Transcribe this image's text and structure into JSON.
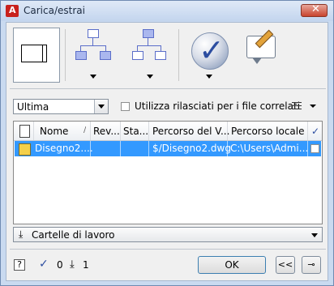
{
  "window": {
    "title": "Carica/estrai",
    "close_glyph": "✕"
  },
  "toolbar": {
    "buttons": [
      {
        "name": "load-sheet",
        "icon": "sheet-icon"
      },
      {
        "name": "tree-a",
        "icon": "hierarchy-icon"
      },
      {
        "name": "tree-b",
        "icon": "hierarchy-icon"
      },
      {
        "name": "check-in",
        "icon": "check-icon"
      },
      {
        "name": "comment",
        "icon": "note-edit-icon"
      }
    ]
  },
  "version_select": {
    "value": "Ultima"
  },
  "related_files": {
    "label": "Utilizza rilasciati per i file correlati",
    "checked": false
  },
  "table": {
    "headers": [
      "Nome",
      "Rev...",
      "Sta...",
      "Percorso del V...",
      "Percorso locale",
      "✓"
    ],
    "rows": [
      {
        "name": "Disegno2....",
        "rev": "",
        "state": "",
        "vault_path": "$/Disegno2.dwg",
        "local_path": "C:\\Users\\Admi...",
        "checked": false
      }
    ]
  },
  "work_folders": {
    "label": "Cartelle di lavoro"
  },
  "footer": {
    "help_label": "?",
    "checked_count": "0",
    "download_count": "1",
    "ok_label": "OK",
    "collapse_label": "<<",
    "pin_label": "⊸"
  },
  "colors": {
    "selection": "#3399ff",
    "title_bar": "#c3d5ee",
    "close": "#c8432d"
  }
}
